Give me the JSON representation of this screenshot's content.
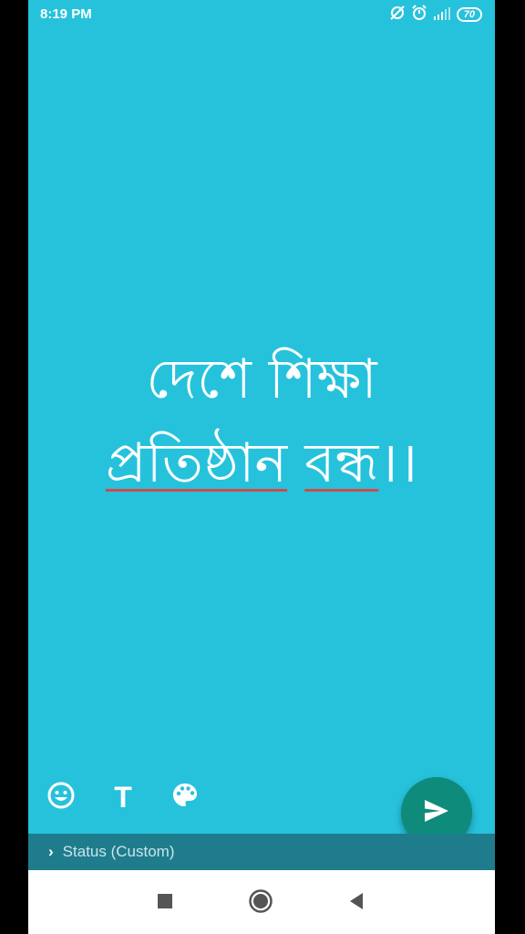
{
  "status_bar": {
    "time": "8:19 PM",
    "battery": "70",
    "icons": [
      "sync-off-icon",
      "alarm-icon",
      "signal-icon",
      "battery-icon"
    ]
  },
  "status_text": {
    "line1": "দেশে শিক্ষা",
    "line2_word1": "প্রতিষ্ঠান",
    "line2_word2": "বন্ধ",
    "line2_end": "।।"
  },
  "tools": {
    "emoji_icon": "emoji-icon",
    "text_icon_label": "T",
    "palette_icon": "palette-icon"
  },
  "recipient_bar": {
    "label": "Status (Custom)"
  },
  "colors": {
    "background": "#26c2dc",
    "fab": "#0f8b7b",
    "recipient_bar": "#1f7c8c"
  }
}
